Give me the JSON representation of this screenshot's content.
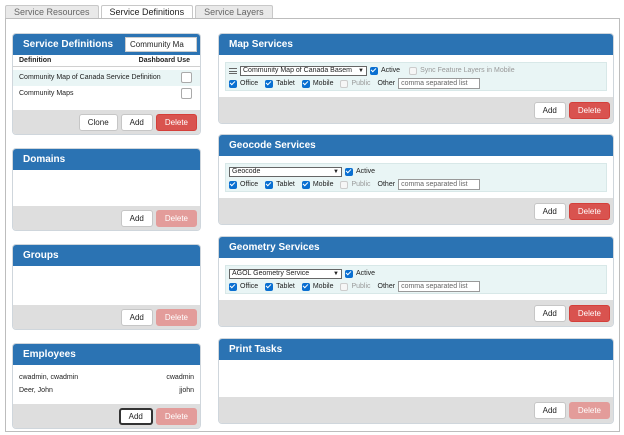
{
  "tabs": [
    "Service Resources",
    "Service Definitions",
    "Service Layers"
  ],
  "service_definitions": {
    "title": "Service Definitions",
    "search_value": "Community Ma",
    "col_definition": "Definition",
    "col_dashboard": "Dashboard Use",
    "rows": [
      "Community Map of Canada Service Definition",
      "Community Maps"
    ],
    "clone": "Clone",
    "add": "Add",
    "delete": "Delete"
  },
  "domains": {
    "title": "Domains",
    "add": "Add",
    "delete": "Delete"
  },
  "groups": {
    "title": "Groups",
    "add": "Add",
    "delete": "Delete"
  },
  "employees": {
    "title": "Employees",
    "rows": [
      {
        "name": "cwadmin, cwadmin",
        "user": "cwadmin"
      },
      {
        "name": "Deer, John",
        "user": "jjohn"
      }
    ],
    "add": "Add",
    "delete": "Delete"
  },
  "map_services": {
    "title": "Map Services",
    "selected": "Community Map of Canada Basem",
    "active": "Active",
    "sync": "Sync Feature Layers in Mobile",
    "office": "Office",
    "tablet": "Tablet",
    "mobile": "Mobile",
    "public": "Public",
    "other": "Other",
    "other_placeholder": "comma separated list",
    "add": "Add",
    "delete": "Delete"
  },
  "geocode_services": {
    "title": "Geocode Services",
    "selected": "Geocode",
    "active": "Active",
    "office": "Office",
    "tablet": "Tablet",
    "mobile": "Mobile",
    "public": "Public",
    "other": "Other",
    "other_placeholder": "comma separated list",
    "add": "Add",
    "delete": "Delete"
  },
  "geometry_services": {
    "title": "Geometry Services",
    "selected": "AGOL Geometry Service",
    "active": "Active",
    "office": "Office",
    "tablet": "Tablet",
    "mobile": "Mobile",
    "public": "Public",
    "other": "Other",
    "other_placeholder": "comma separated list",
    "add": "Add",
    "delete": "Delete"
  },
  "print_tasks": {
    "title": "Print Tasks",
    "add": "Add",
    "delete": "Delete"
  },
  "colors": {
    "header_blue": "#2b73b3",
    "delete_red": "#d9534f",
    "row_highlight": "#e9f5f5",
    "checkbox_blue": "#0a6fd1"
  }
}
